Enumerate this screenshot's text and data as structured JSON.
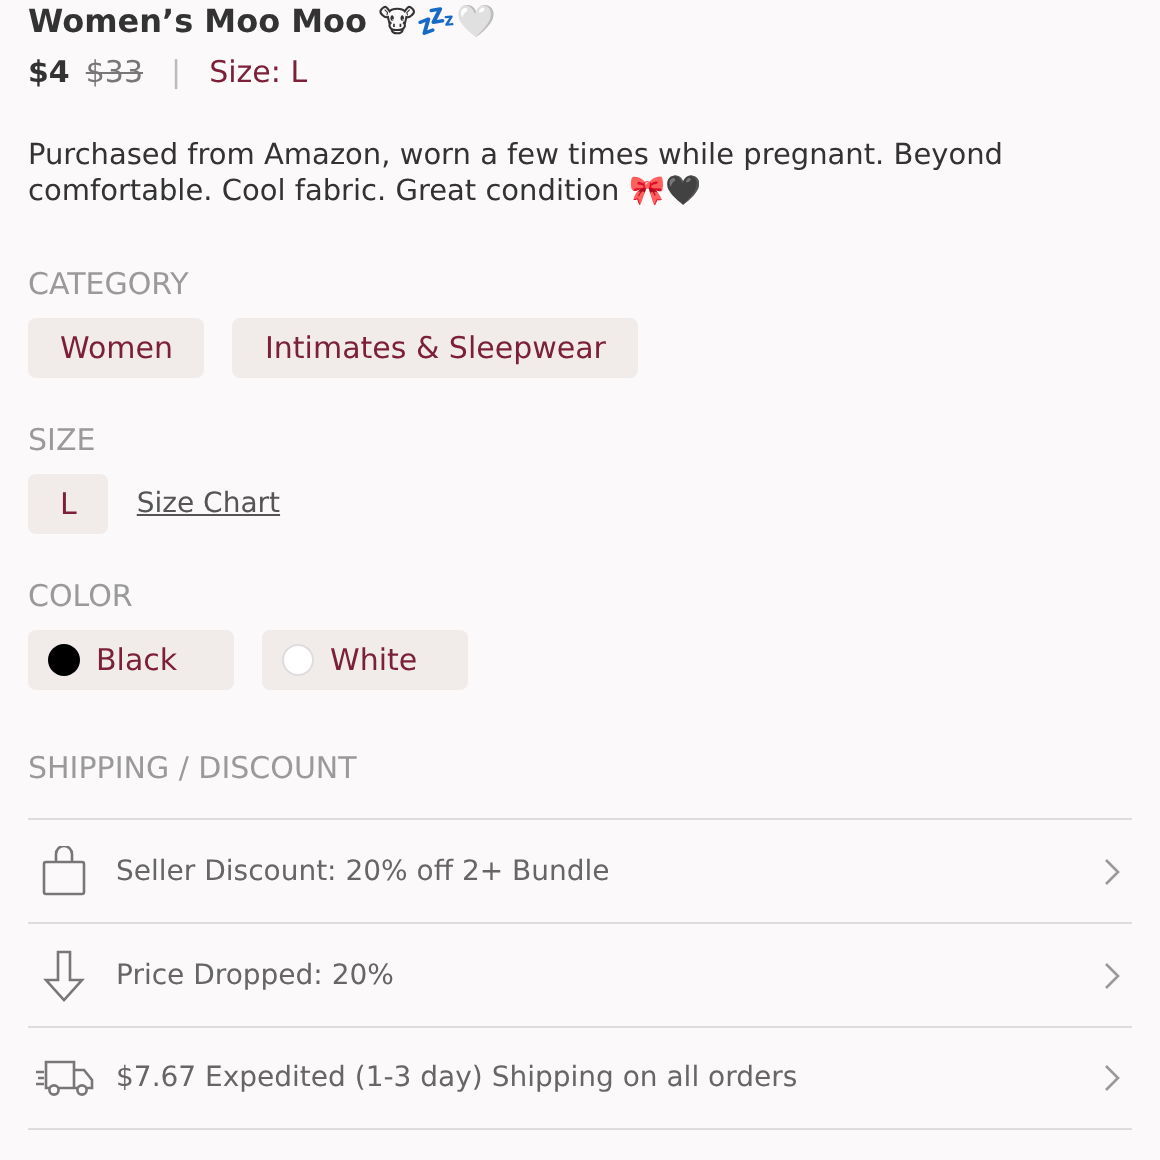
{
  "listing": {
    "title": "Women’s Moo Moo 🐮💤🤍",
    "price": "$4",
    "original_price": "$33",
    "separator": "|",
    "size": "Size: L"
  },
  "description": "Purchased from Amazon, worn a few times while pregnant. Beyond comfortable. Cool fabric. Great condition 🎀🖤",
  "category": {
    "heading": "CATEGORY",
    "chips": [
      "Women",
      "Intimates & Sleepwear"
    ]
  },
  "size": {
    "heading": "SIZE",
    "chips": [
      "L"
    ],
    "link": "Size Chart"
  },
  "color": {
    "heading": "COLOR",
    "chips": [
      {
        "label": "Black",
        "color": "#000000"
      },
      {
        "label": "White",
        "color": "#ffffff"
      }
    ]
  },
  "shipping": {
    "heading": "SHIPPING / DISCOUNT",
    "rows": [
      {
        "kind": "bag",
        "text": "Seller Discount: 20% off 2+ Bundle"
      },
      {
        "kind": "arrow",
        "text": "Price Dropped: 20%"
      },
      {
        "kind": "truck",
        "text": "$7.67 Expedited (1-3 day) Shipping on all orders"
      }
    ]
  }
}
